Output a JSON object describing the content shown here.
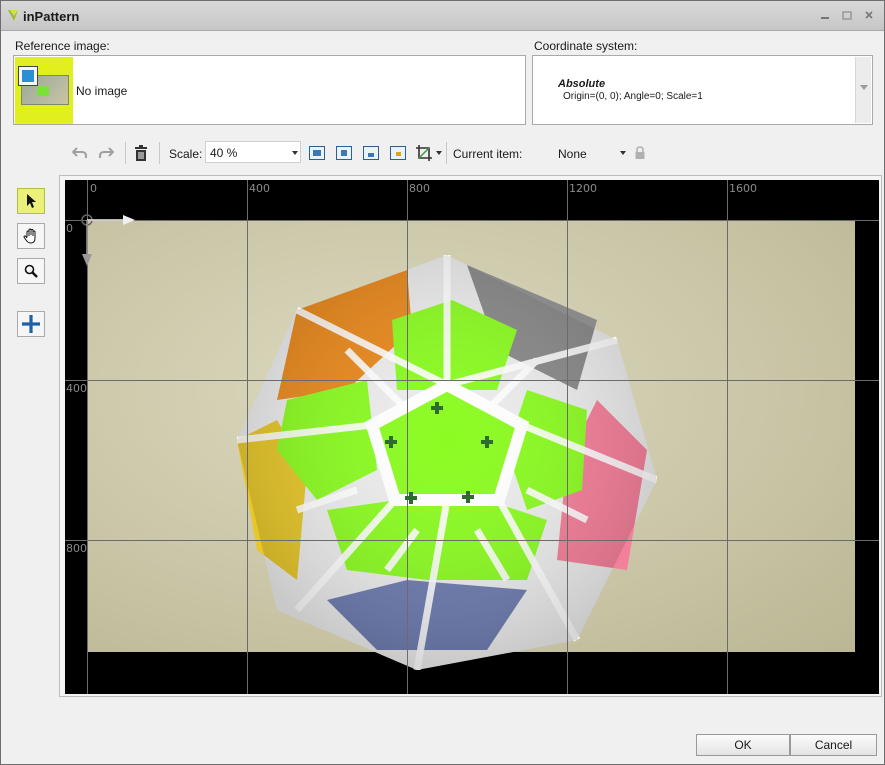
{
  "window": {
    "title": "inPattern"
  },
  "reference": {
    "label": "Reference image:",
    "text": "No image"
  },
  "coordinate": {
    "label": "Coordinate system:",
    "name": "Absolute",
    "details": "Origin=(0, 0); Angle=0; Scale=1"
  },
  "toolbar": {
    "scale_label": "Scale:",
    "scale_value": "40 %",
    "current_item_label": "Current item:",
    "current_item_value": "None"
  },
  "canvas": {
    "ruler_x": [
      "0",
      "400",
      "800",
      "1200",
      "1600"
    ],
    "ruler_y": [
      "0",
      "400",
      "800"
    ]
  },
  "buttons": {
    "ok": "OK",
    "cancel": "Cancel"
  },
  "colors": {
    "accent_yellow": "#e1ef1e",
    "marker_green": "#2e6b2e",
    "canvas_bg": "#000000"
  }
}
